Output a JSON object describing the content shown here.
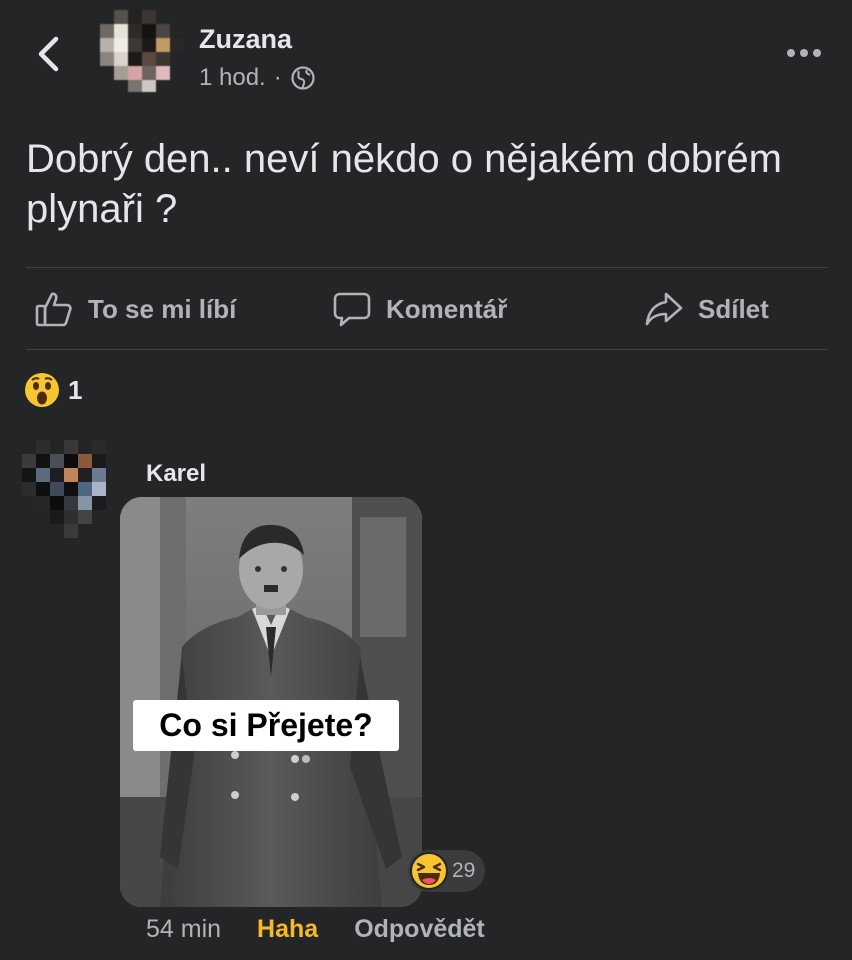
{
  "post": {
    "author": "Zuzana",
    "time": "1 hod.",
    "separator": "·",
    "text": "Dobrý den.. neví někdo o nějakém dobrém plynaři ?"
  },
  "actions": {
    "like": "To se mi líbí",
    "comment": "Komentář",
    "share": "Sdílet"
  },
  "reactions": {
    "icon": "wow-emoji-icon",
    "count": "1"
  },
  "comment": {
    "author": "Karel",
    "image_caption": "Co si Přejete?",
    "reaction_icon": "haha-emoji-icon",
    "reaction_count": "29",
    "time": "54 min",
    "reaction_label": "Haha",
    "reply_label": "Odpovědět"
  },
  "colors": {
    "background": "#242526",
    "text_primary": "#e4e6eb",
    "text_secondary": "#b0b3b8",
    "haha_accent": "#f7b928"
  }
}
